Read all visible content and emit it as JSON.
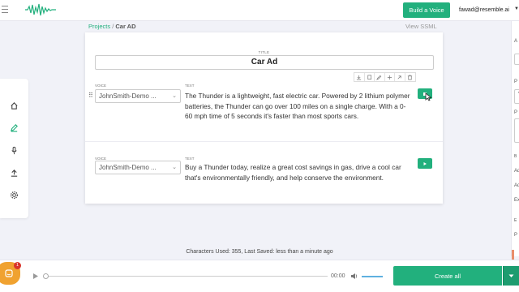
{
  "header": {
    "build_voice_label": "Build a Voice",
    "user_email": "fawad@resemble.ai"
  },
  "breadcrumb": {
    "projects": "Projects",
    "separator": "/",
    "current": "Car AD"
  },
  "view_ssml": "View SSML",
  "title_label": "TITLE",
  "title_value": "Car Ad",
  "rail_icons": [
    "home-icon",
    "edit-icon",
    "microphone-icon",
    "upload-icon",
    "settings-icon"
  ],
  "clip_toolbar_icons": [
    "download-icon",
    "copy-icon",
    "edit-icon",
    "adjust-icon",
    "link-icon",
    "delete-icon"
  ],
  "blocks": [
    {
      "voice_label": "VOICE",
      "voice_value": "JohnSmith-Demo ...",
      "text_label": "TEXT",
      "text": "The Thunder is a lightweight, fast electric car. Powered by 2 lithium polymer batteries, the Thunder can go over 100 miles on a single charge. With a 0-60 mph time of 5 seconds it's faster than most sports cars.",
      "state": "stop"
    },
    {
      "voice_label": "VOICE",
      "voice_value": "JohnSmith-Demo ...",
      "text_label": "TEXT",
      "text": "Buy a Thunder today, realize a great cost savings in gas, drive a cool car that's environmentally friendly, and help conserve the environment.",
      "state": "play"
    }
  ],
  "right_panel": {
    "items": [
      "A",
      "P",
      "T",
      "P",
      "B",
      "Ad",
      "Ad",
      "Ex",
      "E",
      "P"
    ]
  },
  "status": "Characters Used: 355, Last Saved: less than a minute ago",
  "player": {
    "time": "00:00",
    "chat_badge": "1"
  },
  "create_all_label": "Create all",
  "colors": {
    "accent": "#22b07d",
    "chat": "#f0a230",
    "badge": "#d9342b"
  }
}
